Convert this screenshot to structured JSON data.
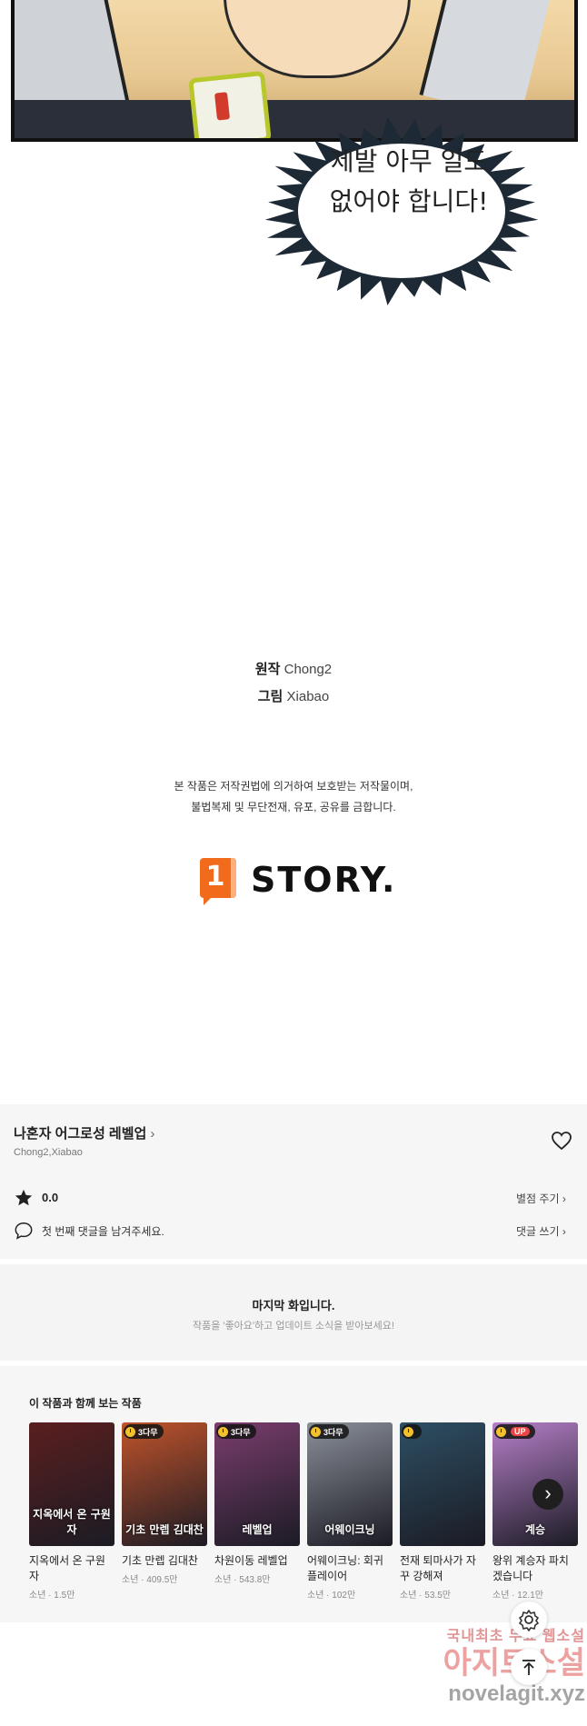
{
  "comic": {
    "speech_line1": "제발 아무 일도",
    "speech_line2": "없어야 합니다!"
  },
  "credits": {
    "original_label": "원작",
    "original_value": "Chong2",
    "art_label": "그림",
    "art_value": "Xiabao"
  },
  "copyright": {
    "line1": "본 작품은 저작권법에 의거하여 보호받는 저작물이며,",
    "line2": "불법복제 및 무단전재, 유포, 공유를 금합니다."
  },
  "logo": {
    "mark": "1",
    "word": "STORY."
  },
  "series": {
    "title": "나혼자 어그로성 레벨업",
    "chevron": "›",
    "authors": "Chong2,Xiabao",
    "rating": "0.0",
    "rate_link": "별점 주기 ›",
    "comment_prompt": "첫 번째 댓글을 남겨주세요.",
    "comment_link": "댓글 쓰기 ›"
  },
  "last_episode": {
    "title": "마지막 화입니다.",
    "subtitle": "작품을 '좋아요'하고 업데이트 소식을 받아보세요!"
  },
  "recommendations": {
    "heading": "이 작품과 함께 보는 작품",
    "items": [
      {
        "title": "지옥에서 온 구원자",
        "meta": "소년 · 1.5만",
        "cover_text": "지옥에서 온 구원자",
        "tag": "",
        "color": "#5a1f1f"
      },
      {
        "title": "기초 만렙 김대찬",
        "meta": "소년 · 409.5만",
        "cover_text": "기초 만렙 김대찬",
        "tag": "3다무",
        "color": "#c0532b"
      },
      {
        "title": "차원이동 레벨업",
        "meta": "소년 · 543.8만",
        "cover_text": "레벨업",
        "tag": "3다무",
        "color": "#7a3d6e"
      },
      {
        "title": "어웨이크닝: 회귀 플레이어",
        "meta": "소년 · 102만",
        "cover_text": "어웨이크닝",
        "tag": "3다무",
        "color": "#8a8f98"
      },
      {
        "title": "전재 퇴마사가 자꾸 강해져",
        "meta": "소년 · 53.5만",
        "cover_text": "",
        "tag": "clock",
        "color": "#2d4f63"
      },
      {
        "title": "왕위 계승자 파치겠습니다",
        "meta": "소년 · 12.1만",
        "cover_text": "계승",
        "tag": "UP",
        "color": "#b57fc8"
      }
    ],
    "next_icon": "›"
  },
  "floating": {
    "settings_icon": "gear-icon",
    "top_icon": "arrow-up-icon"
  },
  "watermark": {
    "line1": "국내최초 무료 웹소설",
    "line2": "아지트소설",
    "line3": "novelagit.xyz"
  }
}
